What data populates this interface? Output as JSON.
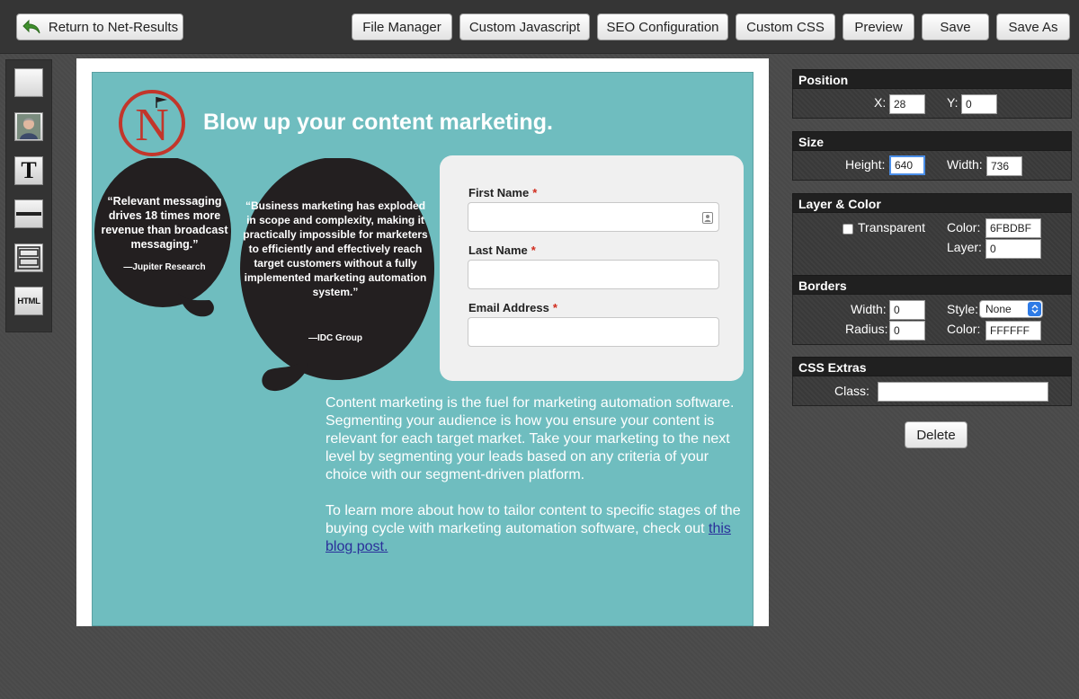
{
  "toolbar": {
    "return_label": "Return to Net-Results",
    "file_manager_label": "File Manager",
    "custom_js_label": "Custom Javascript",
    "seo_label": "SEO Configuration",
    "custom_css_label": "Custom CSS",
    "preview_label": "Preview",
    "save_label": "Save",
    "save_as_label": "Save As"
  },
  "palette": {
    "tools": [
      "box-tool",
      "image-tool",
      "text-tool",
      "divider-tool",
      "form-tool",
      "html-tool"
    ],
    "text_glyph": "T",
    "html_glyph": "HTML"
  },
  "canvas": {
    "logo_letter": "N",
    "headline": "Blow up your content marketing.",
    "quote1": "“Relevant messaging drives 18 times more revenue than broadcast messaging.”",
    "quote1_source": "—Jupiter Research",
    "quote2": "“Business marketing has exploded in scope and complexity, making it practically impossible for marketers to efficiently and effectively reach target customers without a fully implemented marketing automation system.”",
    "quote2_source": "—IDC Group",
    "form": {
      "first_name_label": "First Name",
      "last_name_label": "Last Name",
      "email_label": "Email Address",
      "required_mark": "*"
    },
    "paragraph1": "Content marketing is the fuel for marketing automation software. Segmenting your audience is how you ensure your content is relevant for each target market. Take your marketing to the next level by segmenting your leads based on any criteria of your choice with our segment-driven platform.",
    "paragraph2": "To learn more about how to tailor content to specific stages of the buying cycle with marketing automation software, check out",
    "link_text": "this blog post.",
    "colors": {
      "background": "#6FBDBF",
      "logo_red": "#c2362b",
      "bubble": "#231f20"
    }
  },
  "properties": {
    "position": {
      "title": "Position",
      "x_label": "X:",
      "x_value": "28",
      "y_label": "Y:",
      "y_value": "0"
    },
    "size": {
      "title": "Size",
      "height_label": "Height:",
      "height_value": "640",
      "width_label": "Width:",
      "width_value": "736"
    },
    "layer_color": {
      "title": "Layer & Color",
      "transparent_label": "Transparent",
      "color_label": "Color:",
      "color_value": "6FBDBF",
      "layer_label": "Layer:",
      "layer_value": "0"
    },
    "borders": {
      "title": "Borders",
      "width_label": "Width:",
      "width_value": "0",
      "style_label": "Style:",
      "style_value": "None",
      "radius_label": "Radius:",
      "radius_value": "0",
      "color_label": "Color:",
      "color_value": "FFFFFF"
    },
    "css_extras": {
      "title": "CSS Extras",
      "class_label": "Class:",
      "class_value": ""
    },
    "delete_label": "Delete"
  }
}
